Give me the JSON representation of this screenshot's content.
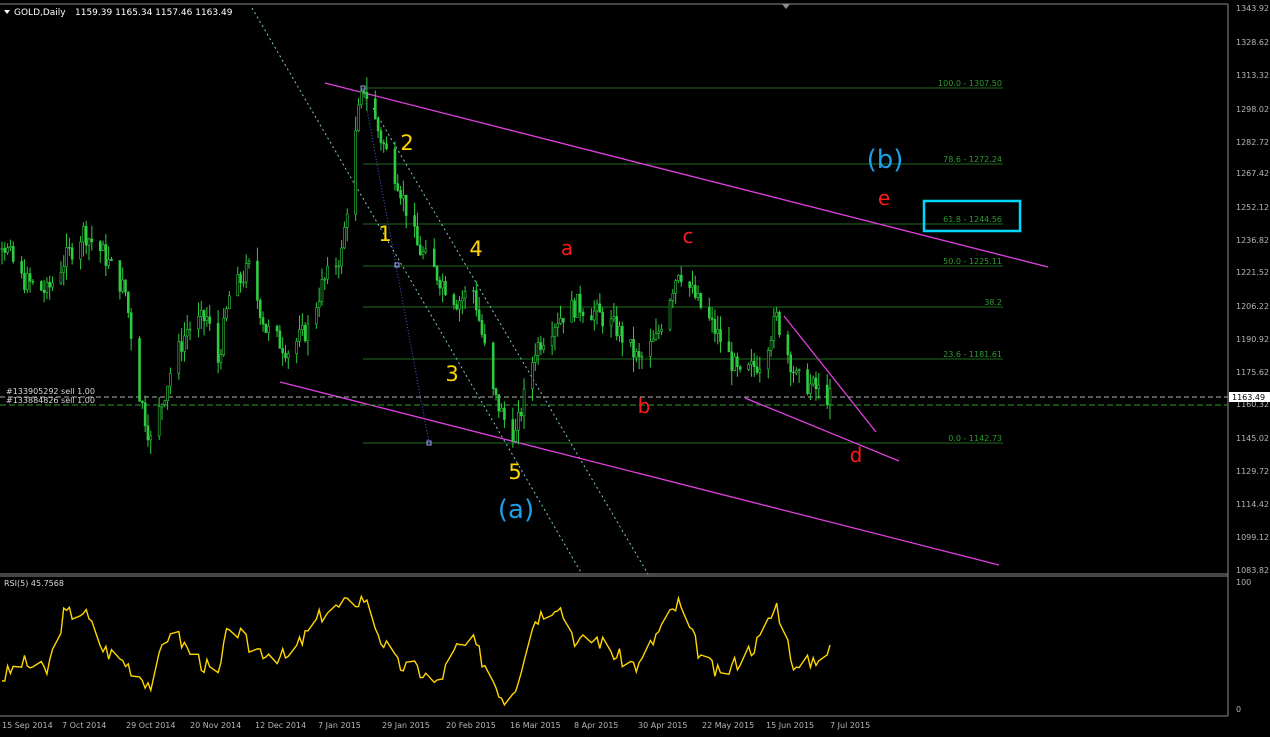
{
  "header": {
    "title": "GOLD,Daily",
    "ohlc": "1159.39 1165.34 1157.46 1163.49"
  },
  "price_axis": {
    "ticks": [
      "1343.92",
      "1328.62",
      "1313.32",
      "1298.02",
      "1282.72",
      "1267.42",
      "1252.12",
      "1236.82",
      "1221.52",
      "1206.22",
      "1190.92",
      "1175.62",
      "1160.32",
      "1145.02",
      "1129.72",
      "1114.42",
      "1099.12",
      "1083.82"
    ],
    "current": "1163.49"
  },
  "date_axis": {
    "ticks": [
      "15 Sep 2014",
      "7 Oct 2014",
      "29 Oct 2014",
      "20 Nov 2014",
      "12 Dec 2014",
      "7 Jan 2015",
      "29 Jan 2015",
      "20 Feb 2015",
      "16 Mar 2015",
      "8 Apr 2015",
      "30 Apr 2015",
      "22 May 2015",
      "15 Jun 2015",
      "7 Jul 2015"
    ]
  },
  "fib_levels": [
    {
      "label": "100.0 - 1307.50"
    },
    {
      "label": "78.6 - 1272.24"
    },
    {
      "label": "61.8 - 1244.56"
    },
    {
      "label": "50.0 - 1225.11"
    },
    {
      "label": "38.2"
    },
    {
      "label": "23.6 - 1181.61"
    },
    {
      "label": "0.0 - 1142.73"
    }
  ],
  "orders": [
    {
      "label": "#133905292 sell 1.00"
    },
    {
      "label": "#133884826 sell 1.00"
    }
  ],
  "waves": {
    "yellow": [
      "1",
      "2",
      "3",
      "4",
      "5"
    ],
    "red": [
      "a",
      "b",
      "c",
      "d",
      "e"
    ],
    "blue": [
      "(a)",
      "(b)"
    ]
  },
  "rsi": {
    "title": "RSI(5) 45.7568",
    "max_label": "100",
    "min_label": "0"
  },
  "colors": {
    "background": "#000000",
    "candles": "#2ecc40",
    "fib": "#1f6b1f",
    "channel": "#e040e0",
    "rsi": "#ffd700",
    "target_box": "#00d7ff",
    "axis_line": "#8c8c8c"
  },
  "chart_data": {
    "type": "candlestick",
    "symbol": "GOLD",
    "timeframe": "Daily",
    "ylim": [
      1083.82,
      1343.92
    ],
    "x_range": [
      "15 Sep 2014",
      "7 Jul 2015"
    ],
    "close_path": [
      [
        "15 Sep 2014",
        1236
      ],
      [
        "22 Sep 2014",
        1218
      ],
      [
        "1 Oct 2014",
        1212
      ],
      [
        "7 Oct 2014",
        1226
      ],
      [
        "14 Oct 2014",
        1240
      ],
      [
        "21 Oct 2014",
        1230
      ],
      [
        "29 Oct 2014",
        1212
      ],
      [
        "3 Nov 2014",
        1165
      ],
      [
        "7 Nov 2014",
        1143
      ],
      [
        "14 Nov 2014",
        1175
      ],
      [
        "20 Nov 2014",
        1195
      ],
      [
        "27 Nov 2014",
        1200
      ],
      [
        "1 Dec 2014",
        1180
      ],
      [
        "5 Dec 2014",
        1210
      ],
      [
        "12 Dec 2014",
        1223
      ],
      [
        "18 Dec 2014",
        1195
      ],
      [
        "26 Dec 2014",
        1185
      ],
      [
        "2 Jan 2015",
        1195
      ],
      [
        "7 Jan 2015",
        1215
      ],
      [
        "14 Jan 2015",
        1230
      ],
      [
        "20 Jan 2015",
        1295
      ],
      [
        "22 Jan 2015",
        1307
      ],
      [
        "28 Jan 2015",
        1283
      ],
      [
        "3 Feb 2015",
        1264
      ],
      [
        "10 Feb 2015",
        1233
      ],
      [
        "17 Feb 2015",
        1220
      ],
      [
        "24 Feb 2015",
        1208
      ],
      [
        "2 Mar 2015",
        1213
      ],
      [
        "9 Mar 2015",
        1165
      ],
      [
        "13 Mar 2015",
        1153
      ],
      [
        "17 Mar 2015",
        1146
      ],
      [
        "24 Mar 2015",
        1186
      ],
      [
        "1 Apr 2015",
        1200
      ],
      [
        "8 Apr 2015",
        1206
      ],
      [
        "15 Apr 2015",
        1202
      ],
      [
        "22 Apr 2015",
        1195
      ],
      [
        "30 Apr 2015",
        1180
      ],
      [
        "6 May 2015",
        1190
      ],
      [
        "14 May 2015",
        1223
      ],
      [
        "22 May 2015",
        1205
      ],
      [
        "29 May 2015",
        1190
      ],
      [
        "5 Jun 2015",
        1172
      ],
      [
        "12 Jun 2015",
        1180
      ],
      [
        "18 Jun 2015",
        1200
      ],
      [
        "25 Jun 2015",
        1172
      ],
      [
        "1 Jul 2015",
        1168
      ],
      [
        "7 Jul 2015",
        1163
      ]
    ],
    "fibonacci": [
      {
        "level": 100.0,
        "price": 1307.5
      },
      {
        "level": 78.6,
        "price": 1272.24
      },
      {
        "level": 61.8,
        "price": 1244.56
      },
      {
        "level": 50.0,
        "price": 1225.11
      },
      {
        "level": 38.2
      },
      {
        "level": 23.6,
        "price": 1181.61
      },
      {
        "level": 0.0,
        "price": 1142.73
      }
    ],
    "rsi": {
      "period": 5,
      "last": 45.7568,
      "ylim": [
        0,
        100
      ],
      "path": [
        [
          "15 Sep 2014",
          25
        ],
        [
          "22 Sep 2014",
          37
        ],
        [
          "1 Oct 2014",
          30
        ],
        [
          "7 Oct 2014",
          74
        ],
        [
          "14 Oct 2014",
          78
        ],
        [
          "21 Oct 2014",
          48
        ],
        [
          "29 Oct 2014",
          37
        ],
        [
          "7 Nov 2014",
          20
        ],
        [
          "14 Nov 2014",
          64
        ],
        [
          "20 Nov 2014",
          48
        ],
        [
          "1 Dec 2014",
          25
        ],
        [
          "5 Dec 2014",
          68
        ],
        [
          "12 Dec 2014",
          50
        ],
        [
          "26 Dec 2014",
          40
        ],
        [
          "7 Jan 2015",
          75
        ],
        [
          "22 Jan 2015",
          88
        ],
        [
          "28 Jan 2015",
          56
        ],
        [
          "3 Feb 2015",
          35
        ],
        [
          "10 Feb 2015",
          32
        ],
        [
          "17 Feb 2015",
          20
        ],
        [
          "24 Feb 2015",
          48
        ],
        [
          "2 Mar 2015",
          52
        ],
        [
          "13 Mar 2015",
          8
        ],
        [
          "17 Mar 2015",
          20
        ],
        [
          "24 Mar 2015",
          72
        ],
        [
          "1 Apr 2015",
          84
        ],
        [
          "8 Apr 2015",
          52
        ],
        [
          "15 Apr 2015",
          56
        ],
        [
          "22 Apr 2015",
          42
        ],
        [
          "30 Apr 2015",
          34
        ],
        [
          "6 May 2015",
          58
        ],
        [
          "14 May 2015",
          83
        ],
        [
          "22 May 2015",
          42
        ],
        [
          "29 May 2015",
          26
        ],
        [
          "5 Jun 2015",
          40
        ],
        [
          "12 Jun 2015",
          55
        ],
        [
          "18 Jun 2015",
          82
        ],
        [
          "25 Jun 2015",
          30
        ],
        [
          "1 Jul 2015",
          40
        ],
        [
          "7 Jul 2015",
          46
        ]
      ]
    }
  }
}
